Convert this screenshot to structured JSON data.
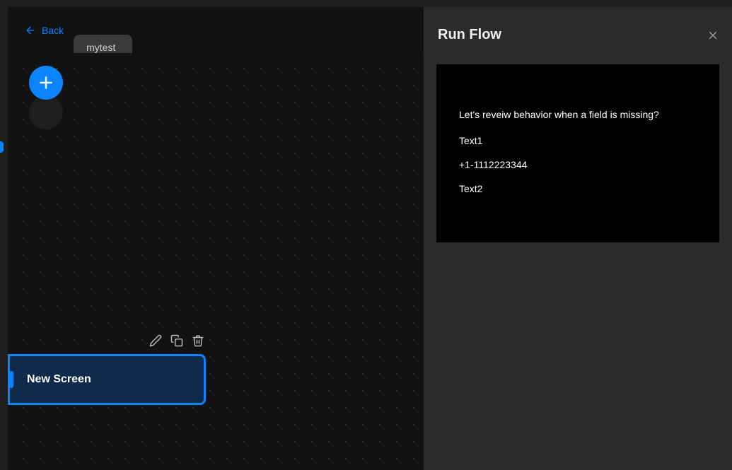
{
  "header": {
    "back_label": "Back",
    "tab_label": "mytest"
  },
  "canvas": {
    "node_label": "New Screen"
  },
  "panel": {
    "title": "Run Flow",
    "preview": {
      "heading": "Let's reveiw behavior when a field is missing?",
      "lines": [
        "Text1",
        "+1-1112223344",
        "Text2"
      ]
    }
  },
  "colors": {
    "accent": "#0a84ff",
    "bg": "#141414",
    "panel": "#2b2b2b"
  }
}
